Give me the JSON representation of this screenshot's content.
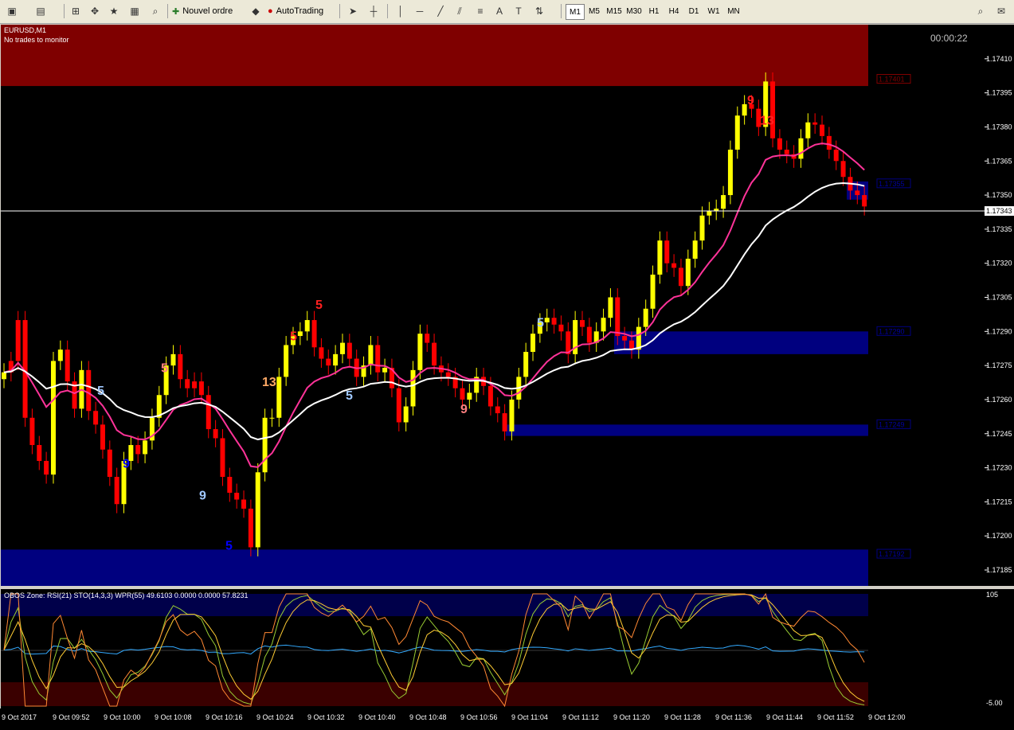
{
  "toolbar": {
    "new_order": "Nouvel ordre",
    "autotrading": "AutoTrading",
    "timeframes": [
      "M1",
      "M5",
      "M15",
      "M30",
      "H1",
      "H4",
      "D1",
      "W1",
      "MN"
    ],
    "active_timeframe": "M1"
  },
  "chart": {
    "symbol": "EURUSD,M1",
    "status": "No trades to monitor",
    "timer": "00:00:22",
    "current_price": "1.17343",
    "price_levels": [
      "1.17410",
      "1.17395",
      "1.17380",
      "1.17365",
      "1.17350",
      "1.17335",
      "1.17320",
      "1.17305",
      "1.17290",
      "1.17275",
      "1.17260",
      "1.17245",
      "1.17230",
      "1.17215",
      "1.17200",
      "1.17185"
    ],
    "zone_labels": [
      "1.17401",
      "1.17355",
      "1.17290",
      "1.17249",
      "1.17192"
    ],
    "setup_counts": [
      "5",
      "9",
      "5",
      "9",
      "5",
      "13",
      "5",
      "5",
      "5",
      "9",
      "5",
      "9",
      "13"
    ]
  },
  "indicator": {
    "title": "OBOS Zone: RSI(21)  STO(14,3,3)  WPR(55)  49.6103 0.0000 0.0000 57.8231",
    "scale_max": "105",
    "scale_min": "-5.00"
  },
  "time_axis": [
    "9 Oct 2017",
    "9 Oct 09:52",
    "9 Oct 10:00",
    "9 Oct 10:08",
    "9 Oct 10:16",
    "9 Oct 10:24",
    "9 Oct 10:32",
    "9 Oct 10:40",
    "9 Oct 10:48",
    "9 Oct 10:56",
    "9 Oct 11:04",
    "9 Oct 11:12",
    "9 Oct 11:20",
    "9 Oct 11:28",
    "9 Oct 11:36",
    "9 Oct 11:44",
    "9 Oct 11:52",
    "9 Oct 12:00"
  ],
  "colors": {
    "bull": "#ffff00",
    "bear": "#ff0000",
    "supply": "#7f0000",
    "demand": "#00007f",
    "ma_fast": "#ff3399",
    "ma_slow": "#ffffff"
  },
  "chart_data": {
    "type": "candlestick",
    "ylim": [
      1.17178,
      1.17425
    ],
    "closes": [
      1.17272,
      1.17277,
      1.17295,
      1.17252,
      1.1724,
      1.17233,
      1.17227,
      1.17277,
      1.17282,
      1.17268,
      1.17256,
      1.17273,
      1.17255,
      1.17249,
      1.17238,
      1.17226,
      1.17214,
      1.17233,
      1.1724,
      1.17236,
      1.17242,
      1.17252,
      1.17262,
      1.17275,
      1.1728,
      1.17269,
      1.17265,
      1.17268,
      1.17262,
      1.17247,
      1.17243,
      1.17226,
      1.17219,
      1.17216,
      1.17212,
      1.17195,
      1.17228,
      1.17252,
      1.17252,
      1.1727,
      1.17284,
      1.17288,
      1.1729,
      1.17295,
      1.17283,
      1.17278,
      1.17275,
      1.1728,
      1.17285,
      1.17278,
      1.1727,
      1.17275,
      1.17284,
      1.17272,
      1.17274,
      1.17265,
      1.1725,
      1.17257,
      1.17273,
      1.17289,
      1.17285,
      1.17275,
      1.17272,
      1.1727,
      1.17265,
      1.1726,
      1.17263,
      1.1727,
      1.17266,
      1.17257,
      1.17254,
      1.17246,
      1.1726,
      1.1727,
      1.17281,
      1.17289,
      1.17294,
      1.17296,
      1.17293,
      1.1729,
      1.1728,
      1.17295,
      1.17292,
      1.17285,
      1.1729,
      1.17296,
      1.17305,
      1.17288,
      1.17286,
      1.17282,
      1.17292,
      1.173,
      1.17315,
      1.1733,
      1.1732,
      1.17318,
      1.1731,
      1.17322,
      1.1733,
      1.17341,
      1.17343,
      1.17344,
      1.1735,
      1.1737,
      1.17385,
      1.1739,
      1.17388,
      1.1738,
      1.174,
      1.17375,
      1.1737,
      1.17368,
      1.17366,
      1.17375,
      1.17382,
      1.17381,
      1.17376,
      1.1737,
      1.17365,
      1.17358,
      1.17352,
      1.1735,
      1.17345
    ],
    "bullish": [
      true,
      false,
      false,
      false,
      false,
      false,
      false,
      true,
      true,
      false,
      false,
      true,
      false,
      false,
      false,
      false,
      false,
      true,
      true,
      false,
      true,
      true,
      true,
      true,
      true,
      false,
      false,
      false,
      false,
      false,
      false,
      false,
      false,
      false,
      false,
      false,
      true,
      true,
      true,
      true,
      true,
      true,
      true,
      true,
      false,
      false,
      false,
      true,
      true,
      false,
      false,
      true,
      true,
      false,
      true,
      false,
      false,
      true,
      true,
      true,
      false,
      false,
      false,
      false,
      false,
      false,
      true,
      true,
      false,
      false,
      false,
      false,
      true,
      true,
      true,
      true,
      true,
      true,
      false,
      false,
      false,
      true,
      false,
      false,
      true,
      true,
      true,
      false,
      false,
      false,
      true,
      true,
      true,
      true,
      false,
      false,
      false,
      true,
      true,
      true,
      true,
      true,
      true,
      true,
      true,
      true,
      false,
      false,
      true,
      false,
      false,
      false,
      false,
      true,
      true,
      false,
      false,
      false,
      false,
      false,
      false,
      false,
      false
    ]
  }
}
